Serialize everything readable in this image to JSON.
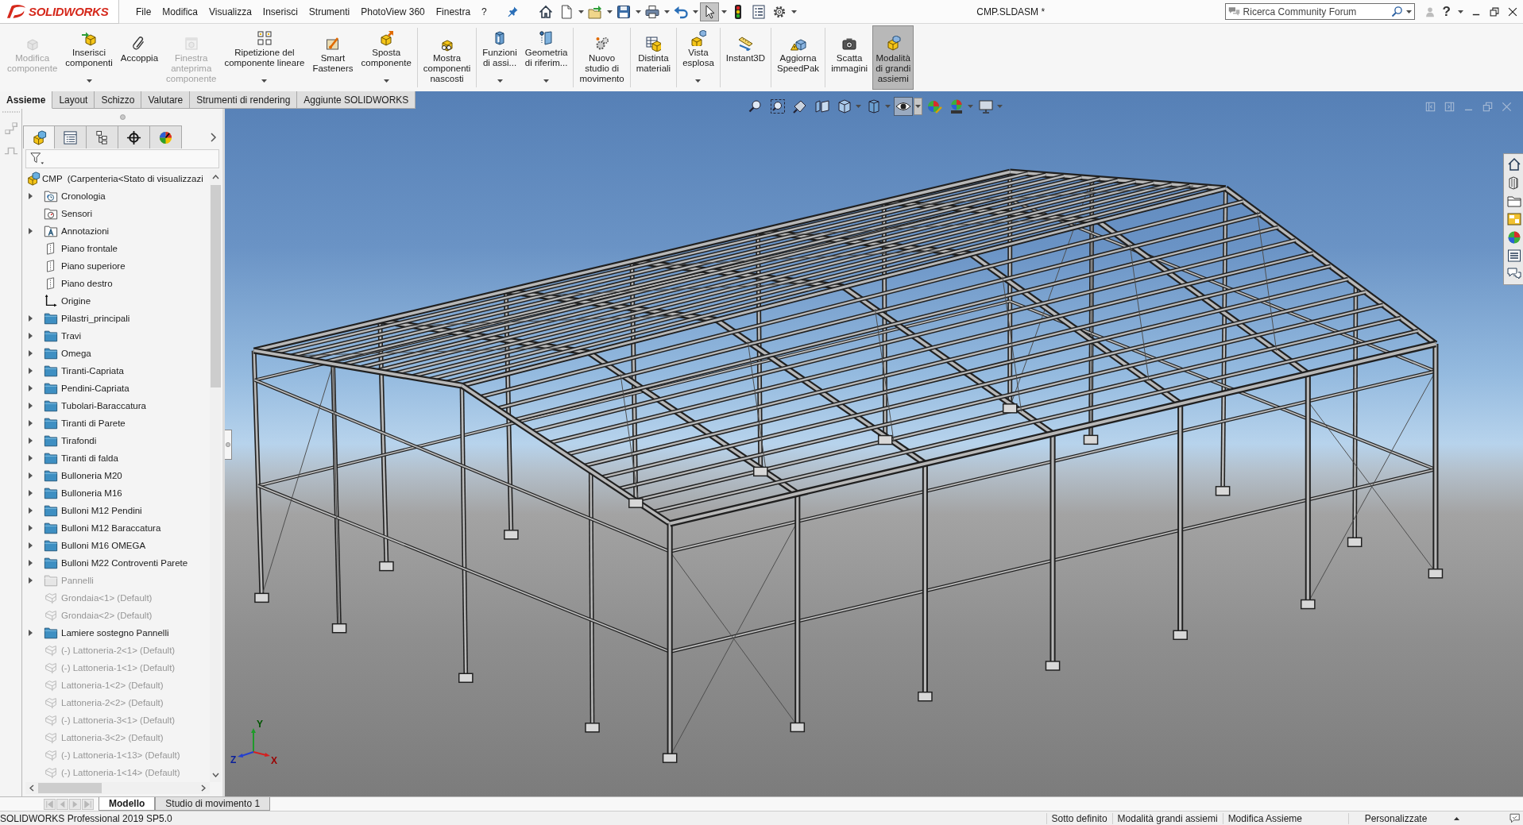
{
  "app": {
    "logo": "SOLIDWORKS",
    "title": "CMP.SLDASM *"
  },
  "menu": [
    "File",
    "Modifica",
    "Visualizza",
    "Inserisci",
    "Strumenti",
    "PhotoView 360",
    "Finestra",
    "?"
  ],
  "quick_access": [
    {
      "dropdown": false,
      "selected": false
    },
    {
      "dropdown": true,
      "selected": false
    },
    {
      "dropdown": true,
      "selected": false
    },
    {
      "dropdown": true,
      "selected": false
    },
    {
      "dropdown": true,
      "selected": false
    },
    {
      "dropdown": true,
      "selected": false
    },
    {
      "dropdown": true,
      "selected": true
    },
    {
      "dropdown": false,
      "selected": false
    },
    {
      "dropdown": false,
      "selected": false
    },
    {
      "dropdown": true,
      "selected": false
    }
  ],
  "search": {
    "placeholder": "Ricerca Community Forum"
  },
  "help": {
    "label": "?"
  },
  "ribbon": {
    "groups": [
      [
        {
          "lines": [
            "Modifica",
            "componente"
          ],
          "disabled": true,
          "dropdown": false,
          "selected": false
        },
        {
          "lines": [
            "Inserisci",
            "componenti"
          ],
          "disabled": false,
          "dropdown": true,
          "selected": false
        },
        {
          "lines": [
            "Accoppia"
          ],
          "disabled": false,
          "dropdown": false,
          "selected": false
        },
        {
          "lines": [
            "Finestra",
            "anteprima",
            "componente"
          ],
          "disabled": true,
          "dropdown": false,
          "selected": false
        },
        {
          "lines": [
            "Ripetizione del",
            "componente lineare"
          ],
          "disabled": false,
          "dropdown": true,
          "selected": false
        },
        {
          "lines": [
            "Smart",
            "Fasteners"
          ],
          "disabled": false,
          "dropdown": false,
          "selected": false
        },
        {
          "lines": [
            "Sposta",
            "componente"
          ],
          "disabled": false,
          "dropdown": true,
          "selected": false
        }
      ],
      [
        {
          "lines": [
            "Mostra",
            "componenti",
            "nascosti"
          ],
          "disabled": false,
          "dropdown": false,
          "selected": false
        }
      ],
      [
        {
          "lines": [
            "Funzioni",
            "di assi..."
          ],
          "disabled": false,
          "dropdown": true,
          "selected": false
        },
        {
          "lines": [
            "Geometria",
            "di riferim..."
          ],
          "disabled": false,
          "dropdown": true,
          "selected": false
        }
      ],
      [
        {
          "lines": [
            "Nuovo",
            "studio di",
            "movimento"
          ],
          "disabled": false,
          "dropdown": false,
          "selected": false
        }
      ],
      [
        {
          "lines": [
            "Distinta",
            "materiali"
          ],
          "disabled": false,
          "dropdown": false,
          "selected": false
        }
      ],
      [
        {
          "lines": [
            "Vista",
            "esplosa"
          ],
          "disabled": false,
          "dropdown": true,
          "selected": false
        }
      ],
      [
        {
          "lines": [
            "Instant3D"
          ],
          "disabled": false,
          "dropdown": false,
          "selected": false
        }
      ],
      [
        {
          "lines": [
            "Aggiorna",
            "SpeedPak"
          ],
          "disabled": false,
          "dropdown": false,
          "selected": false
        }
      ],
      [
        {
          "lines": [
            "Scatta",
            "immagini"
          ],
          "disabled": false,
          "dropdown": false,
          "selected": false
        },
        {
          "lines": [
            "Modalità",
            "di grandi",
            "assiemi"
          ],
          "disabled": false,
          "dropdown": false,
          "selected": true
        }
      ]
    ]
  },
  "command_tabs": [
    {
      "label": "Assieme",
      "selected": true
    },
    {
      "label": "Layout",
      "selected": false
    },
    {
      "label": "Schizzo",
      "selected": false
    },
    {
      "label": "Valutare",
      "selected": false
    },
    {
      "label": "Strumenti di rendering",
      "selected": false
    },
    {
      "label": "Aggiunte SOLIDWORKS",
      "selected": false
    }
  ],
  "panel_tabs": [
    {
      "selected": true
    },
    {
      "selected": false
    },
    {
      "selected": false
    },
    {
      "selected": false
    },
    {
      "selected": false
    }
  ],
  "tree": {
    "root": {
      "label": "CMP  (Carpenteria<Stato di visualizzazi",
      "kind": "assembly",
      "children": [
        {
          "label": "Cronologia",
          "kind": "history",
          "expandable": true,
          "hidden": false
        },
        {
          "label": "Sensori",
          "kind": "sensors",
          "expandable": false,
          "hidden": false
        },
        {
          "label": "Annotazioni",
          "kind": "annotations",
          "expandable": true,
          "hidden": false
        },
        {
          "label": "Piano frontale",
          "kind": "plane",
          "expandable": false,
          "hidden": false
        },
        {
          "label": "Piano superiore",
          "kind": "plane",
          "expandable": false,
          "hidden": false
        },
        {
          "label": "Piano destro",
          "kind": "plane",
          "expandable": false,
          "hidden": false
        },
        {
          "label": "Origine",
          "kind": "origin",
          "expandable": false,
          "hidden": false
        },
        {
          "label": "Pilastri_principali",
          "kind": "folder",
          "expandable": true,
          "hidden": false
        },
        {
          "label": "Travi",
          "kind": "folder",
          "expandable": true,
          "hidden": false
        },
        {
          "label": "Omega",
          "kind": "folder",
          "expandable": true,
          "hidden": false
        },
        {
          "label": "Tiranti-Capriata",
          "kind": "folder",
          "expandable": true,
          "hidden": false
        },
        {
          "label": "Pendini-Capriata",
          "kind": "folder",
          "expandable": true,
          "hidden": false
        },
        {
          "label": "Tubolari-Baraccatura",
          "kind": "folder",
          "expandable": true,
          "hidden": false
        },
        {
          "label": "Tiranti di Parete",
          "kind": "folder",
          "expandable": true,
          "hidden": false
        },
        {
          "label": "Tirafondi",
          "kind": "folder",
          "expandable": true,
          "hidden": false
        },
        {
          "label": "Tiranti di falda",
          "kind": "folder",
          "expandable": true,
          "hidden": false
        },
        {
          "label": "Bulloneria M20",
          "kind": "folder",
          "expandable": true,
          "hidden": false
        },
        {
          "label": "Bulloneria M16",
          "kind": "folder",
          "expandable": true,
          "hidden": false
        },
        {
          "label": "Bulloni M12 Pendini",
          "kind": "folder",
          "expandable": true,
          "hidden": false
        },
        {
          "label": "Bulloni M12 Baraccatura",
          "kind": "folder",
          "expandable": true,
          "hidden": false
        },
        {
          "label": "Bulloni M16 OMEGA",
          "kind": "folder",
          "expandable": true,
          "hidden": false
        },
        {
          "label": "Bulloni M22 Controventi Parete",
          "kind": "folder",
          "expandable": true,
          "hidden": false
        },
        {
          "label": "Pannelli",
          "kind": "folder",
          "expandable": true,
          "hidden": true
        },
        {
          "label": "Grondaia<1> (Default)",
          "kind": "part",
          "expandable": false,
          "hidden": true
        },
        {
          "label": "Grondaia<2> (Default)",
          "kind": "part",
          "expandable": false,
          "hidden": true
        },
        {
          "label": "Lamiere sostegno Pannelli",
          "kind": "folder",
          "expandable": true,
          "hidden": false
        },
        {
          "label": "(-) Lattoneria-2<1> (Default)",
          "kind": "part",
          "expandable": false,
          "hidden": true
        },
        {
          "label": "(-) Lattoneria-1<1> (Default)",
          "kind": "part",
          "expandable": false,
          "hidden": true
        },
        {
          "label": "Lattoneria-1<2> (Default)",
          "kind": "part",
          "expandable": false,
          "hidden": true
        },
        {
          "label": "Lattoneria-2<2> (Default)",
          "kind": "part",
          "expandable": false,
          "hidden": true
        },
        {
          "label": "(-) Lattoneria-3<1> (Default)",
          "kind": "part",
          "expandable": false,
          "hidden": true
        },
        {
          "label": "Lattoneria-3<2> (Default)",
          "kind": "part",
          "expandable": false,
          "hidden": true
        },
        {
          "label": "(-) Lattoneria-1<13> (Default)",
          "kind": "part",
          "expandable": false,
          "hidden": true
        },
        {
          "label": "(-) Lattoneria-1<14> (Default)",
          "kind": "part",
          "expandable": false,
          "hidden": true
        }
      ]
    }
  },
  "view_toolbar": [
    {
      "dropdown": false,
      "selected": false
    },
    {
      "dropdown": false,
      "selected": false
    },
    {
      "dropdown": false,
      "selected": false
    },
    {
      "dropdown": false,
      "selected": false
    },
    {
      "dropdown": true,
      "selected": false
    },
    {
      "dropdown": true,
      "selected": false
    },
    {
      "dropdown": true,
      "selected": true
    },
    {
      "dropdown": false,
      "selected": false
    },
    {
      "dropdown": true,
      "selected": false
    },
    {
      "dropdown": true,
      "selected": false
    }
  ],
  "triad": {
    "x": "X",
    "y": "Y",
    "z": "Z"
  },
  "bottom_tabs": [
    {
      "label": "Modello",
      "selected": true
    },
    {
      "label": "Studio di movimento 1",
      "selected": false
    }
  ],
  "status_bar": {
    "product": "SOLIDWORKS Professional 2019 SP5.0",
    "fields": [
      "Sotto definito",
      "Modalità grandi assiemi",
      "Modifica Assieme"
    ],
    "units": "Personalizzate"
  }
}
